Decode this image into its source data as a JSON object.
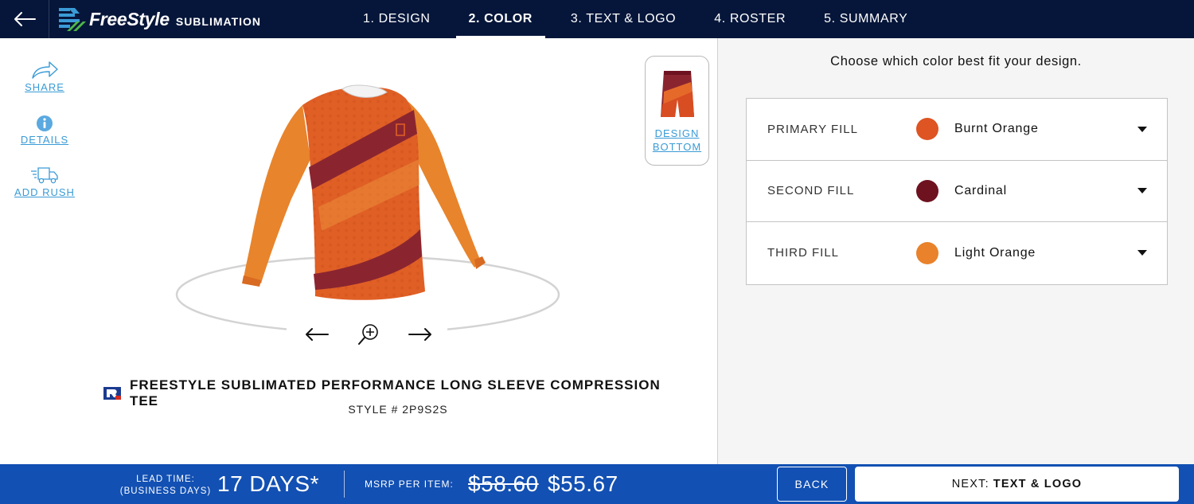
{
  "header": {
    "back_icon": "arrow-left-icon",
    "logo_main": "FreeStyle",
    "logo_sub": "SUBLIMATION",
    "steps": [
      {
        "label": "1. DESIGN",
        "active": false
      },
      {
        "label": "2. COLOR",
        "active": true
      },
      {
        "label": "3. TEXT & LOGO",
        "active": false
      },
      {
        "label": "4. ROSTER",
        "active": false
      },
      {
        "label": "5. SUMMARY",
        "active": false
      }
    ]
  },
  "tools": {
    "share": {
      "label": "SHARE",
      "icon": "share-arrow-icon"
    },
    "details": {
      "label": "DETAILS",
      "icon": "info-icon"
    },
    "rush": {
      "label": "ADD RUSH",
      "icon": "truck-icon"
    }
  },
  "viewer": {
    "controls": [
      "rotate-left-icon",
      "zoom-in-icon",
      "rotate-right-icon"
    ]
  },
  "thumbnail": {
    "label_line1": "DESIGN",
    "label_line2": "BOTTOM"
  },
  "product": {
    "name": "FREESTYLE SUBLIMATED PERFORMANCE LONG SLEEVE COMPRESSION TEE",
    "style": "STYLE # 2P9S2S"
  },
  "color_panel": {
    "heading": "Choose which color best fit your design.",
    "fills": [
      {
        "label": "PRIMARY FILL",
        "value": "Burnt Orange",
        "color": "#de5423"
      },
      {
        "label": "SECOND FILL",
        "value": "Cardinal",
        "color": "#6e1220"
      },
      {
        "label": "THIRD FILL",
        "value": "Light Orange",
        "color": "#e9822a"
      }
    ]
  },
  "footer": {
    "lead_label_1": "LEAD TIME:",
    "lead_label_2": "(BUSINESS DAYS)",
    "lead_value": "17 DAYS*",
    "msrp_label": "MSRP PER ITEM:",
    "price_old": "$58.60",
    "price_new": "$55.67",
    "back_label": "BACK",
    "next_prefix": "NEXT:",
    "next_label": "TEXT & LOGO"
  },
  "colors": {
    "nav_bg": "#06163a",
    "footer_bg": "#1250b3",
    "link": "#3a9bd6"
  }
}
